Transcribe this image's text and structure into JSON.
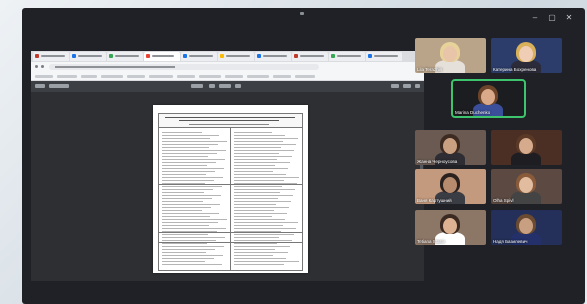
{
  "window": {
    "controls": {
      "minimize": "–",
      "maximize": "▢",
      "close": "✕"
    }
  },
  "browser": {
    "tab_count": 10,
    "active_tab": 7,
    "toolbar_text": "PDF Viewer"
  },
  "participants": [
    {
      "name": "Lila Terazhiri",
      "speaking": false,
      "bg": "#b9a48a"
    },
    {
      "name": "Катерина Бохренова",
      "speaking": false,
      "bg": "#2c3d6b"
    },
    {
      "name": "Marina Duchenko",
      "speaking": true,
      "bg": "#1c1d20"
    },
    {
      "name": "Жанна Черноусова",
      "speaking": false,
      "bg": "#6a5a52"
    },
    {
      "name": "",
      "speaking": false,
      "bg": "#4b2e24"
    },
    {
      "name": "Ваня Картушний",
      "speaking": false,
      "bg": "#c49a7e"
    },
    {
      "name": "Olha Spivl",
      "speaking": false,
      "bg": "#5c4a42"
    },
    {
      "name": "Tetiana Stasiv",
      "speaking": false,
      "bg": "#8c7666"
    },
    {
      "name": "Надя Базилевич",
      "speaking": false,
      "bg": "#243059"
    }
  ],
  "colors": {
    "speaking_border": "#3ec46d",
    "background": "#1f2126"
  }
}
